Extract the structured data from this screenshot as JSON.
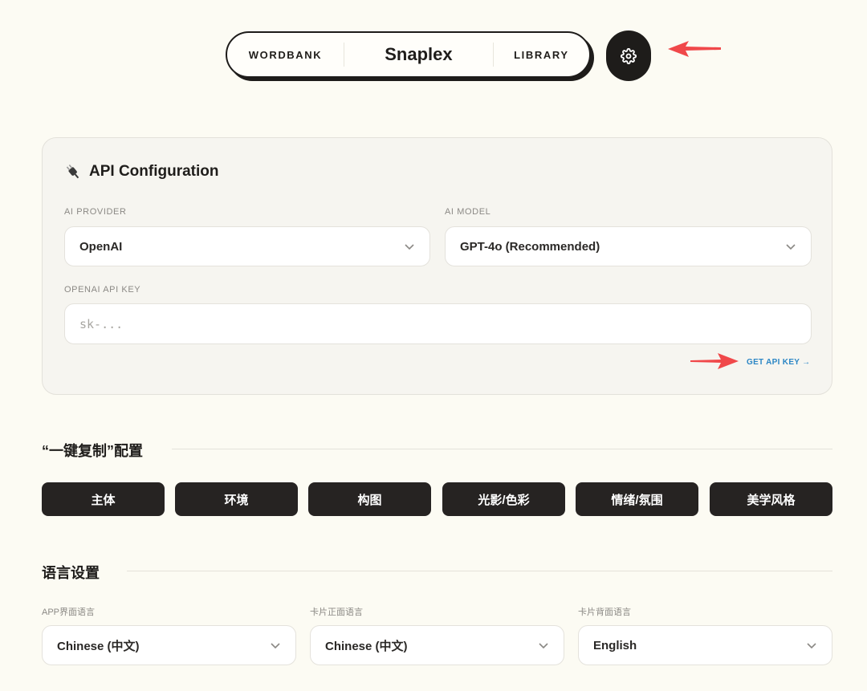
{
  "nav": {
    "left": "WORDBANK",
    "logo": "Snaplex",
    "right": "LIBRARY",
    "settings_icon": "gear-icon"
  },
  "api_config": {
    "icon": "plug-icon",
    "title": "API Configuration",
    "provider_label": "AI PROVIDER",
    "provider_value": "OpenAI",
    "model_label": "AI MODEL",
    "model_value": "GPT-4o (Recommended)",
    "key_label": "OPENAI API KEY",
    "key_placeholder": "sk-...",
    "key_value": "",
    "get_key_link": "GET API KEY →"
  },
  "copy_config": {
    "title": "“一键复制”配置",
    "chips": [
      "主体",
      "环境",
      "构图",
      "光影/色彩",
      "情绪/氛围",
      "美学风格"
    ]
  },
  "language": {
    "title": "语言设置",
    "app_label": "APP界面语言",
    "app_value": "Chinese (中文)",
    "front_label": "卡片正面语言",
    "front_value": "Chinese (中文)",
    "back_label": "卡片背面语言",
    "back_value": "English"
  },
  "colors": {
    "background": "#fcfbf3",
    "dark": "#1e1c1a",
    "link": "#2b86c5",
    "annotation_arrow": "#f0484a"
  }
}
